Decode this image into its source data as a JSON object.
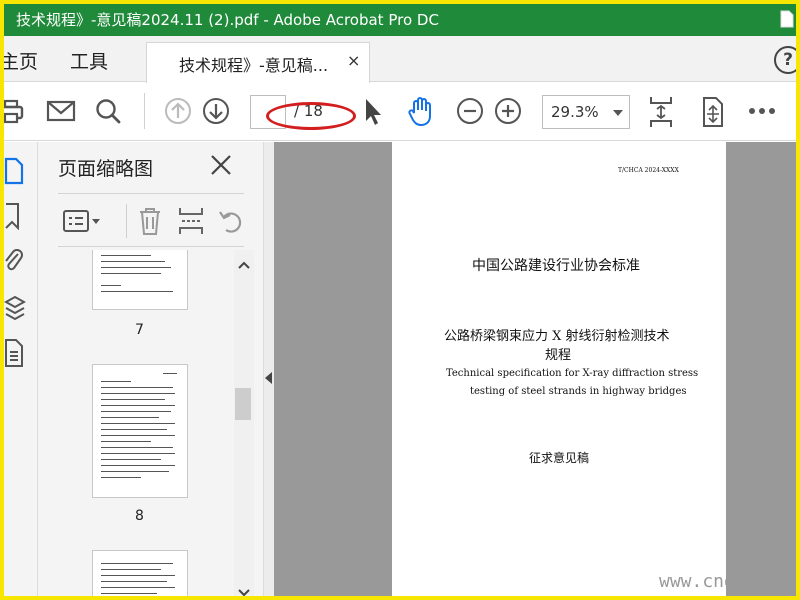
{
  "window": {
    "title": "技术规程》-意见稿2024.11 (2).pdf - Adobe Acrobat Pro DC",
    "titlebar_color": "#1f8a3a",
    "frame_color": "#f6e600"
  },
  "tabs": {
    "home": "主页",
    "tools": "工具",
    "document": "技术规程》-意见稿...",
    "close_glyph": "×",
    "help": "?"
  },
  "toolbar": {
    "page_current": "",
    "page_total": "/ 18",
    "zoom": "29.3%"
  },
  "thumbnail_panel": {
    "title": "页面缩略图",
    "pages": [
      "7",
      "8"
    ]
  },
  "document_page": {
    "standard_code": "T/CHCA 2024-XXXX",
    "organization": "中国公路建设行业协会标准",
    "title_cn_line1": "公路桥梁钢束应力 X 射线衍射检测技术",
    "title_cn_line2": "规程",
    "title_en_line1": "Technical specification for X-ray diffraction stress",
    "title_en_line2": "testing of steel strands in highway bridges",
    "status": "征求意见稿"
  },
  "watermark": "www.cnd",
  "annotation_color": "#d21e1e"
}
